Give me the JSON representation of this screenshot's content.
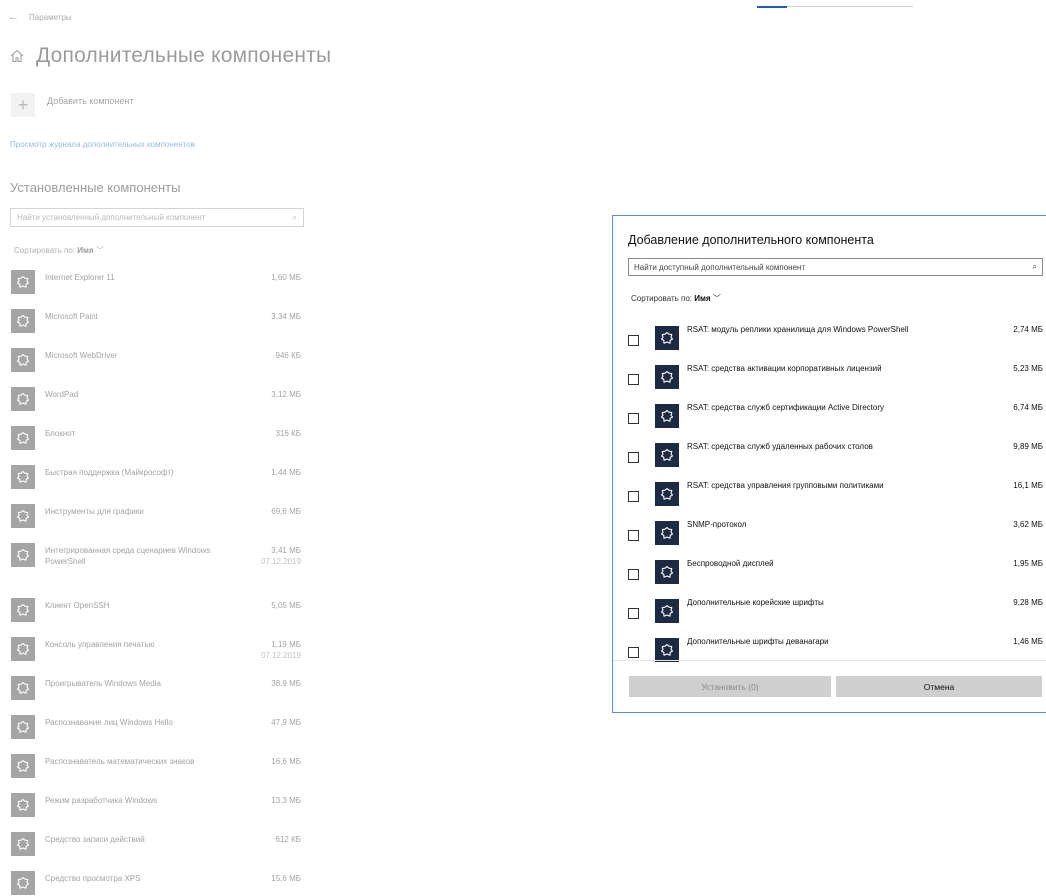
{
  "topbar": {
    "back": "←",
    "label": "Параметры"
  },
  "page": {
    "title": "Дополнительные компоненты"
  },
  "add": {
    "label": "Добавить компонент"
  },
  "history_link": "Просмотр журнала дополнительных компонентов",
  "installed": {
    "title": "Установленные компоненты",
    "search_placeholder": "Найти установленный дополнительный компонент",
    "sort_label": "Сортировать по:",
    "sort_value": "Имя",
    "items": [
      {
        "name": "Internet Explorer 11",
        "size": "1,60 МБ",
        "date": ""
      },
      {
        "name": "Microsoft Paint",
        "size": "3,34 МБ",
        "date": ""
      },
      {
        "name": "Microsoft WebDriver",
        "size": "946 КБ",
        "date": ""
      },
      {
        "name": "WordPad",
        "size": "3,12 МБ",
        "date": ""
      },
      {
        "name": "Блокнот",
        "size": "316 КБ",
        "date": ""
      },
      {
        "name": "Быстрая поддержка (Майкрософт)",
        "size": "1,44 МБ",
        "date": ""
      },
      {
        "name": "Инструменты для графики",
        "size": "69,6 МБ",
        "date": ""
      },
      {
        "name": "Интегрированная среда сценариев Windows PowerShell",
        "size": "3,41 МБ",
        "date": "07.12.2019"
      },
      {
        "name": "Клиент OpenSSH",
        "size": "5,05 МБ",
        "date": ""
      },
      {
        "name": "Консоль управления печатью",
        "size": "1,19 МБ",
        "date": "07.12.2019"
      },
      {
        "name": "Проигрыватель Windows Media",
        "size": "38,9 МБ",
        "date": ""
      },
      {
        "name": "Распознавание лиц Windows Hello",
        "size": "47,9 МБ",
        "date": ""
      },
      {
        "name": "Распознаватель математических знаков",
        "size": "16,6 МБ",
        "date": ""
      },
      {
        "name": "Режим разработчика Windows",
        "size": "13,3 МБ",
        "date": ""
      },
      {
        "name": "Средство записи действий",
        "size": "612 КБ",
        "date": ""
      },
      {
        "name": "Средство просмотра XPS",
        "size": "15,6 МБ",
        "date": ""
      }
    ]
  },
  "dialog": {
    "title": "Добавление дополнительного компонента",
    "search_placeholder": "Найти доступный дополнительный компонент",
    "sort_label": "Сортировать по:",
    "sort_value": "Имя",
    "items": [
      {
        "name": "RSAT: модуль реплики хранилища для Windows PowerShell",
        "size": "2,74 МБ",
        "checked": false
      },
      {
        "name": "RSAT: средства активации корпоративных лицензий",
        "size": "5,23 МБ",
        "checked": false
      },
      {
        "name": "RSAT: средства служб сертификации Active Directory",
        "size": "6,74 МБ",
        "checked": false
      },
      {
        "name": "RSAT: средства служб удаленных рабочих столов",
        "size": "9,89 МБ",
        "checked": false
      },
      {
        "name": "RSAT: средства управления групповыми политиками",
        "size": "16,1 МБ",
        "checked": false
      },
      {
        "name": "SNMP-протокол",
        "size": "3,62 МБ",
        "checked": false
      },
      {
        "name": "Беспроводной дисплей",
        "size": "1,95 МБ",
        "checked": false
      },
      {
        "name": "Дополнительные корейские шрифты",
        "size": "9,28 МБ",
        "checked": false
      },
      {
        "name": "Дополнительные шрифты деванагари",
        "size": "1,46 МБ",
        "checked": false
      }
    ],
    "install_label": "Установить (0)",
    "cancel_label": "Отмена"
  },
  "colors": {
    "accent": "#0a58b8",
    "icon_tile": "#1d2a44",
    "dialog_border": "#5a8fd0",
    "button": "#cfcfcf"
  },
  "icons": {
    "component": "puzzle-icon",
    "home": "home-icon",
    "add": "plus-icon",
    "search": "search-icon",
    "sort": "chevron-down-icon",
    "back": "back-arrow-icon"
  }
}
